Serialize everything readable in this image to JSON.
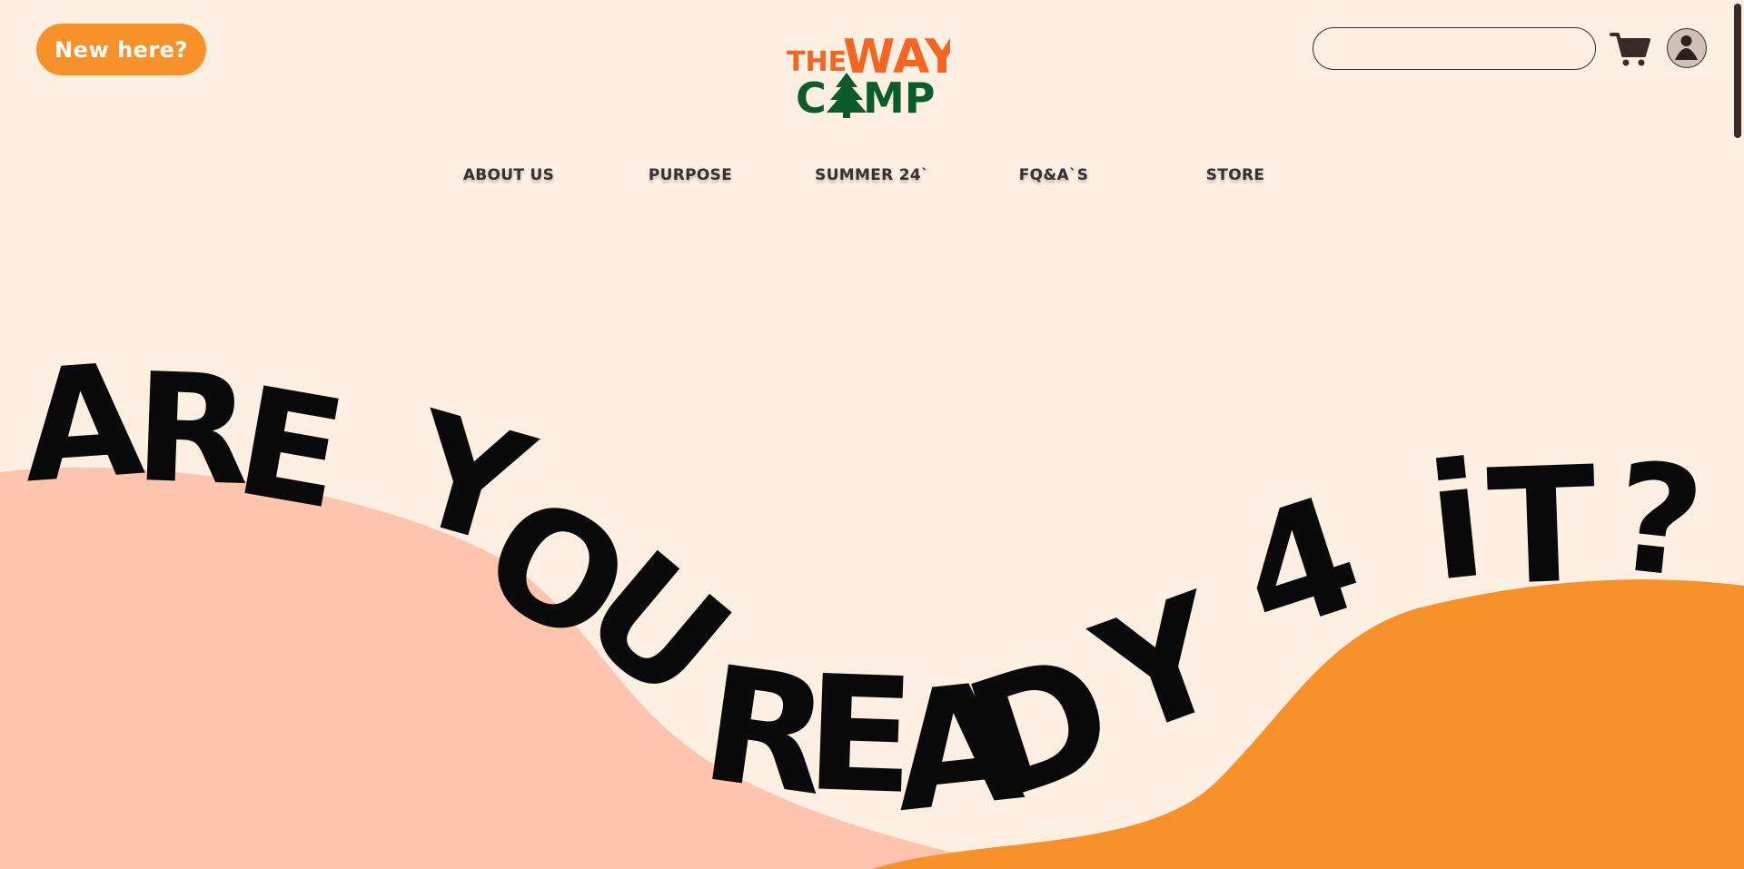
{
  "header": {
    "new_here_label": "New here?",
    "logo": {
      "line1_prefix": "THE",
      "line1_main": "WAY",
      "line2_left": "C",
      "line2_right": "MP"
    },
    "search_placeholder": "",
    "cart_icon": "cart-icon",
    "avatar_icon": "user-icon"
  },
  "nav": {
    "items": [
      {
        "label": "ABOUT US"
      },
      {
        "label": "PURPOSE"
      },
      {
        "label": "SUMMER 24`"
      },
      {
        "label": "FQ&A`S"
      },
      {
        "label": "STORE"
      }
    ]
  },
  "hero": {
    "headline": "ARE YOU READY 4 iT?",
    "letters": [
      "A",
      "R",
      "E",
      "Y",
      "O",
      "U",
      "R",
      "E",
      "A",
      "D",
      "Y",
      "4",
      "i",
      "T",
      "?"
    ]
  },
  "colors": {
    "background": "#fdf0e3",
    "accent_orange": "#f7922a",
    "pink_hill": "#ffc4ad",
    "logo_orange": "#f26522",
    "logo_green": "#0c5b2c",
    "text_dark": "#3a2f2f"
  }
}
